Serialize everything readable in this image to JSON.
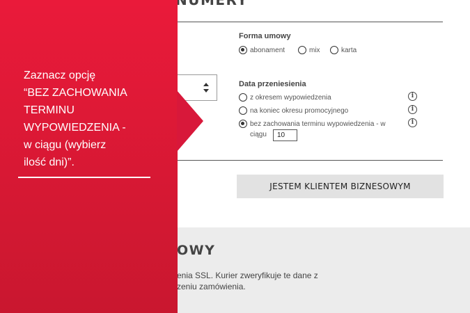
{
  "header": {
    "title_fragment": "NUMERY"
  },
  "form_type": {
    "label": "Forma umowy",
    "options": [
      {
        "label": "abonament",
        "checked": true
      },
      {
        "label": "mix",
        "checked": false
      },
      {
        "label": "karta",
        "checked": false
      }
    ]
  },
  "transfer_date": {
    "label": "Data przeniesienia",
    "options": [
      {
        "label": "z okresem wypowiedzenia",
        "checked": false
      },
      {
        "label": "na koniec okresu promocyjnego",
        "checked": false
      },
      {
        "label": "bez zachowania terminu wypowiedzenia - w",
        "label_cont": "ciągu",
        "checked": true
      }
    ],
    "days_value": "10"
  },
  "business_button": {
    "label": "JESTEM KLIENTEM BIZNESOWYM"
  },
  "lower_section": {
    "heading_fragment": "OWY",
    "line1": "enia SSL. Kurier zweryfikuje te dane z",
    "line2": "zeniu zamówienia."
  },
  "tutorial_overlay": {
    "lines": [
      "Zaznacz opcję",
      "“BEZ ZACHOWANIA",
      "TERMINU",
      "WYPOWIEDZENIA -",
      "w ciągu (wybierz",
      "ilość dni)”."
    ]
  },
  "colors": {
    "overlay_red": "#e11d38",
    "button_grey": "#e2e2e2",
    "section_grey": "#ececec"
  }
}
